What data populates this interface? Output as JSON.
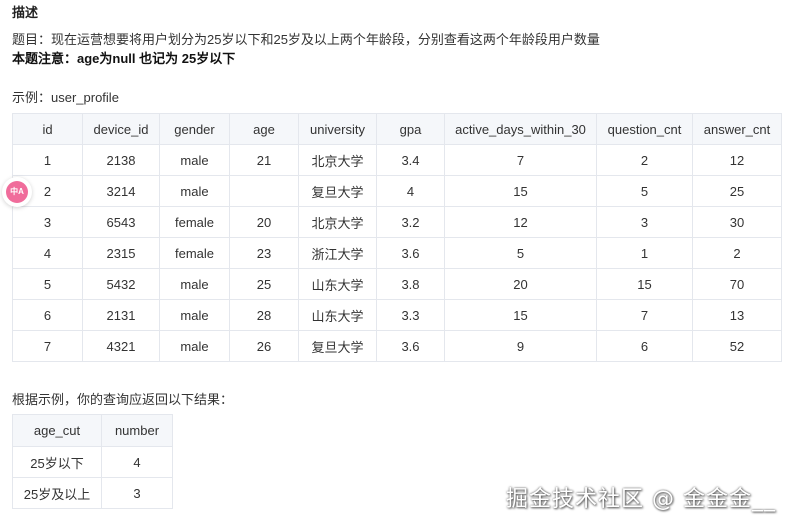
{
  "heading": "描述",
  "problem": "题目：现在运营想要将用户划分为25岁以下和25岁及以上两个年龄段，分别查看这两个年龄段用户数量",
  "note": "本题注意：age为null 也记为 25岁以下",
  "example_label": "示例：user_profile",
  "table": {
    "columns": [
      "id",
      "device_id",
      "gender",
      "age",
      "university",
      "gpa",
      "active_days_within_30",
      "question_cnt",
      "answer_cnt"
    ],
    "rows": [
      [
        "1",
        "2138",
        "male",
        "21",
        "北京大学",
        "3.4",
        "7",
        "2",
        "12"
      ],
      [
        "2",
        "3214",
        "male",
        "",
        "复旦大学",
        "4",
        "15",
        "5",
        "25"
      ],
      [
        "3",
        "6543",
        "female",
        "20",
        "北京大学",
        "3.2",
        "12",
        "3",
        "30"
      ],
      [
        "4",
        "2315",
        "female",
        "23",
        "浙江大学",
        "3.6",
        "5",
        "1",
        "2"
      ],
      [
        "5",
        "5432",
        "male",
        "25",
        "山东大学",
        "3.8",
        "20",
        "15",
        "70"
      ],
      [
        "6",
        "2131",
        "male",
        "28",
        "山东大学",
        "3.3",
        "15",
        "7",
        "13"
      ],
      [
        "7",
        "4321",
        "male",
        "26",
        "复旦大学",
        "3.6",
        "9",
        "6",
        "52"
      ]
    ]
  },
  "result_label": "根据示例，你的查询应返回以下结果：",
  "result": {
    "columns": [
      "age_cut",
      "number"
    ],
    "rows": [
      [
        "25岁以下",
        "4"
      ],
      [
        "25岁及以上",
        "3"
      ]
    ]
  },
  "side_badge": {
    "icon": "translate-icon",
    "text": "中A",
    "color": "#f06c9b"
  },
  "watermark": "掘金技术社区 @ 金金金__"
}
